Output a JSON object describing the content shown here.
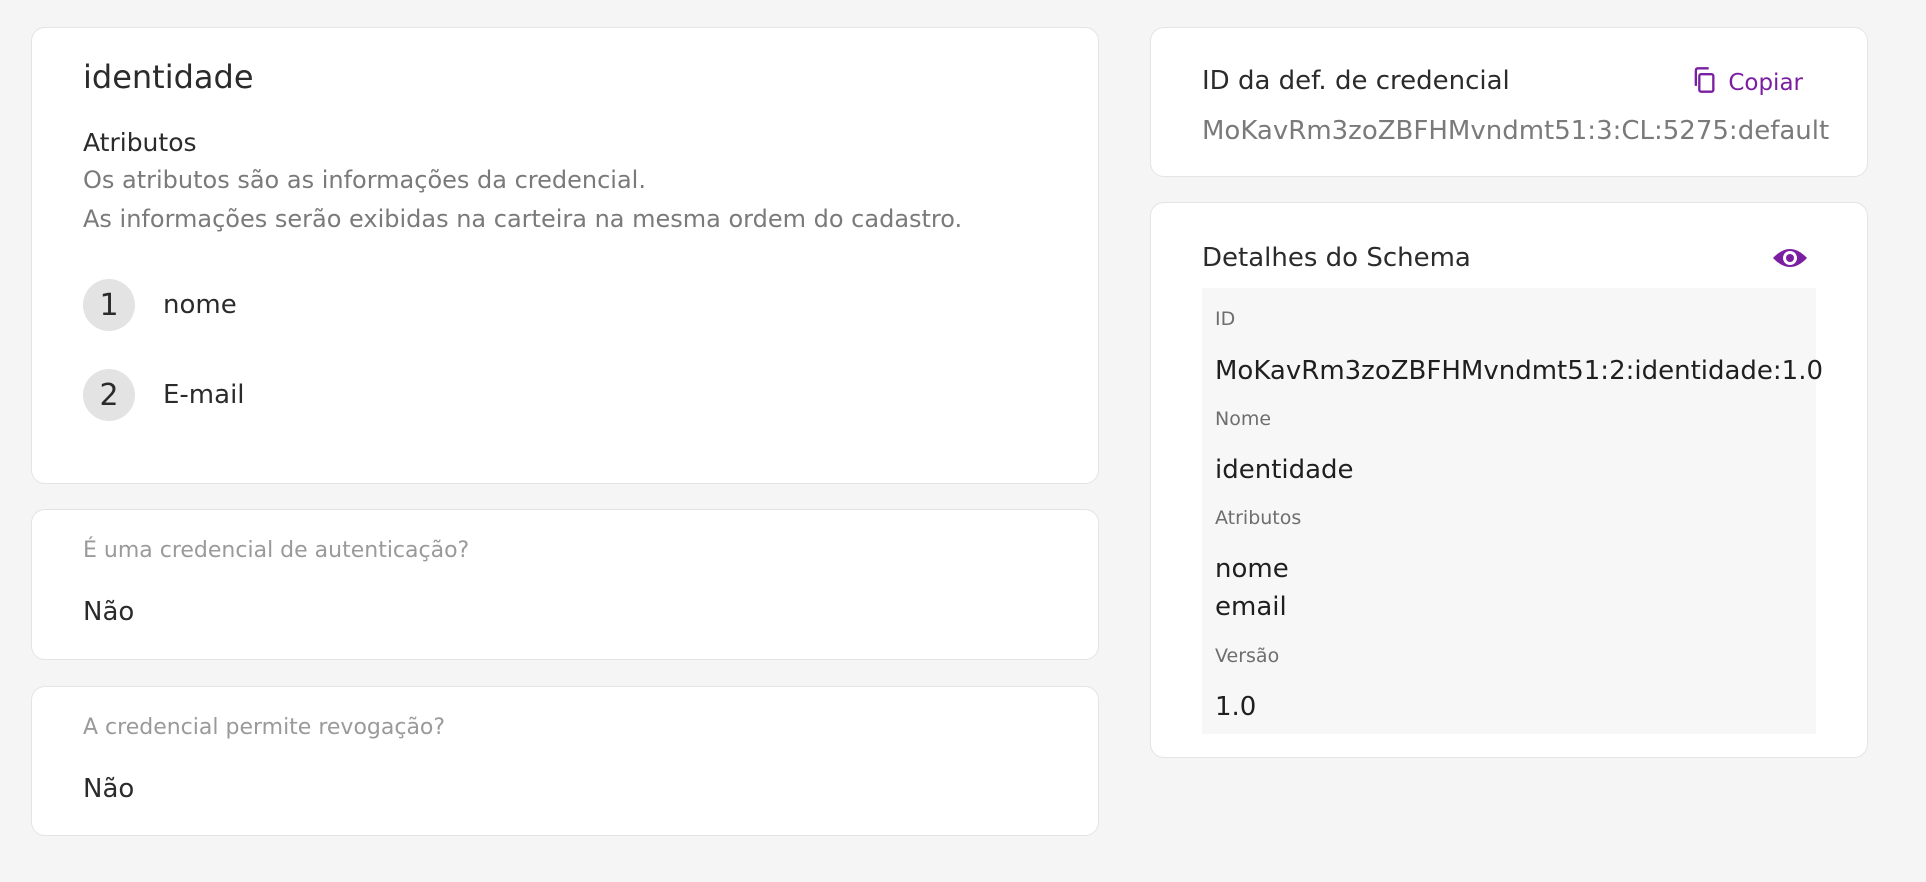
{
  "attributes_card": {
    "title": "identidade",
    "section_label": "Atributos",
    "description_line1": "Os atributos são as informações da credencial.",
    "description_line2": "As informações serão exibidas na carteira na mesma ordem do cadastro.",
    "items": [
      {
        "number": "1",
        "name": "nome"
      },
      {
        "number": "2",
        "name": "E-mail"
      }
    ]
  },
  "auth_card": {
    "question": "É uma credencial de autenticação?",
    "answer": "Não"
  },
  "revoke_card": {
    "question": "A credencial permite revogação?",
    "answer": "Não"
  },
  "credential_card": {
    "title": "ID da def. de credencial",
    "copy_label": "Copiar",
    "copy_icon": "copy-icon",
    "credential_id": "MoKavRm3zoZBFHMvndmt51:3:CL:5275:default"
  },
  "schema_card": {
    "title": "Detalhes do Schema",
    "toggle_icon": "eye-icon",
    "id_label": "ID",
    "id_value": "MoKavRm3zoZBFHMvndmt51:2:identidade:1.0",
    "name_label": "Nome",
    "name_value": "identidade",
    "attributes_label": "Atributos",
    "attributes": [
      "nome",
      "email"
    ],
    "version_label": "Versão",
    "version_value": "1.0"
  },
  "colors": {
    "accent": "#7b1fa2",
    "background": "#f5f5f5",
    "card": "#ffffff"
  }
}
